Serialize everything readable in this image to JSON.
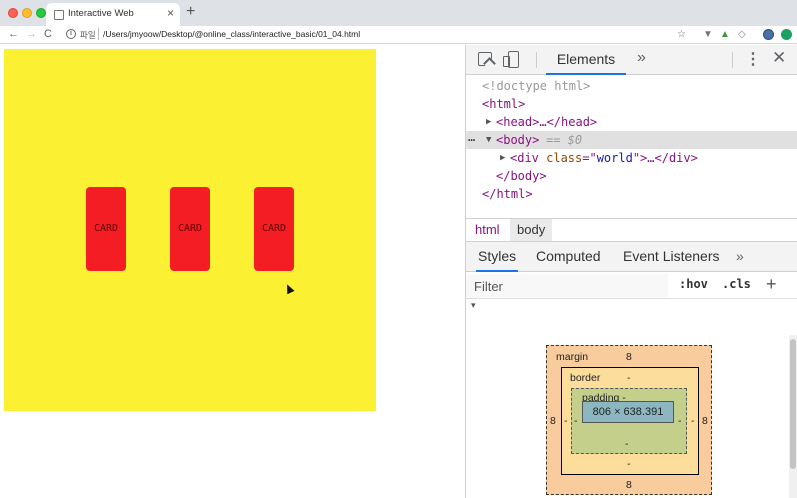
{
  "browser": {
    "tab_title": "Interactive Web",
    "tab_close": "×",
    "new_tab": "+",
    "scheme_label": "파일",
    "url": "/Users/jmyoow/Desktop/@online_class/interactive_basic/01_04.html",
    "back": "←",
    "forward": "→",
    "reload": "C",
    "info": "i",
    "star": "☆",
    "ext1": "▼",
    "ext2": "▲",
    "ext3": "◇"
  },
  "page": {
    "world_color": "#fbf032",
    "card_color": "#f41d23",
    "cards": [
      "CARD",
      "CARD",
      "CARD"
    ]
  },
  "devtools": {
    "tab_elements": "Elements",
    "more_tabs": "»",
    "kebab": "⋮",
    "close": "✕",
    "dom": {
      "doctype": "<!doctype html>",
      "html_open": "<html>",
      "head": "<head>…</head>",
      "body_open": "<body>",
      "body_eq": "== $0",
      "body_dots": "…",
      "div_tag_open": "<div ",
      "div_attr": "class",
      "div_eq": "=\"",
      "div_val": "world",
      "div_rest": "\">…</div>",
      "body_close": "</body>",
      "html_close": "</html>"
    },
    "breadcrumbs": [
      "html",
      "body"
    ],
    "styles_tabs": {
      "styles": "Styles",
      "computed": "Computed",
      "events": "Event Listeners",
      "more": "»"
    },
    "filter": {
      "placeholder": "Filter",
      "hov": ":hov",
      "cls": ".cls",
      "add": "+"
    },
    "box_model": {
      "margin_label": "margin",
      "margin_top": "8",
      "margin_bottom": "8",
      "margin_left": "8",
      "margin_right": "8",
      "border_label": "border",
      "border_top": "-",
      "border_bottom": "-",
      "border_left": "-",
      "border_right": "-",
      "padding_label": "padding -",
      "padding_bottom": "-",
      "padding_left": "-",
      "padding_right": "-",
      "content": "806 × 638.391"
    }
  }
}
